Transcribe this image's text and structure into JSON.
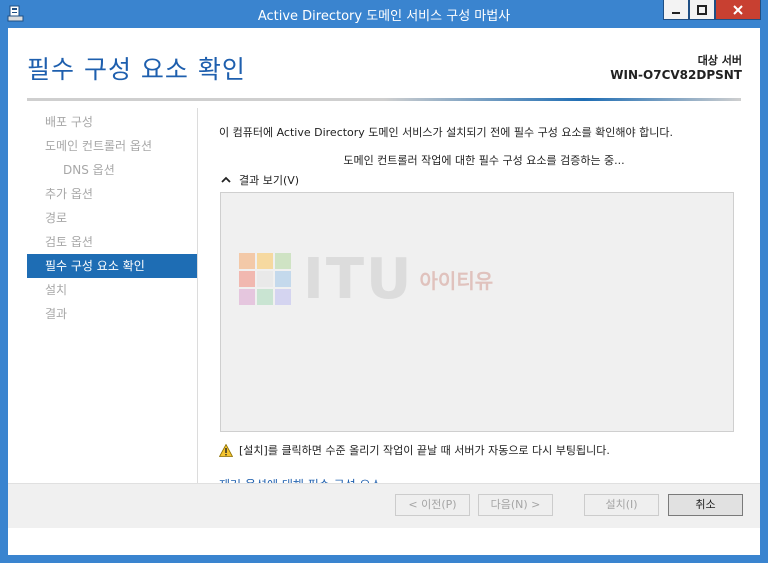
{
  "window": {
    "title": "Active Directory 도메인 서비스 구성 마법사",
    "icon": "server-wizard-icon",
    "accent": "#3a84cf"
  },
  "header": {
    "page_title": "필수 구성 요소 확인",
    "target_label": "대상 서버",
    "target_server": "WIN-O7CV82DPSNT"
  },
  "nav": {
    "items": [
      {
        "label": "배포 구성",
        "state": "disabled"
      },
      {
        "label": "도메인 컨트롤러 옵션",
        "state": "disabled"
      },
      {
        "label": "DNS 옵션",
        "state": "disabled"
      },
      {
        "label": "추가 옵션",
        "state": "disabled"
      },
      {
        "label": "경로",
        "state": "disabled"
      },
      {
        "label": "검토 옵션",
        "state": "disabled"
      },
      {
        "label": "필수 구성 요소 확인",
        "state": "active"
      },
      {
        "label": "설치",
        "state": "disabled"
      },
      {
        "label": "결과",
        "state": "disabled"
      }
    ],
    "active_color": "#1e6db4"
  },
  "content": {
    "description": "이 컴퓨터에 Active Directory 도메인 서비스가 설치되기 전에 필수 구성 요소를 확인해야 합니다.",
    "status": "도메인 컨트롤러 작업에 대한 필수 구성 요소를 검증하는 중...",
    "results_toggle": "결과 보기(V)",
    "watermark_word": "ITU",
    "watermark_sub": "아이티유",
    "warning": "[설치]를 클릭하면 수준 올리기 작업이 끝날 때 서버가 자동으로 다시 부팅됩니다.",
    "link": "제거 옵션에 대해 필수 구성 요소"
  },
  "footer": {
    "prev": "< 이전(P)",
    "next": "다음(N) >",
    "install": "설치(I)",
    "cancel": "취소"
  }
}
